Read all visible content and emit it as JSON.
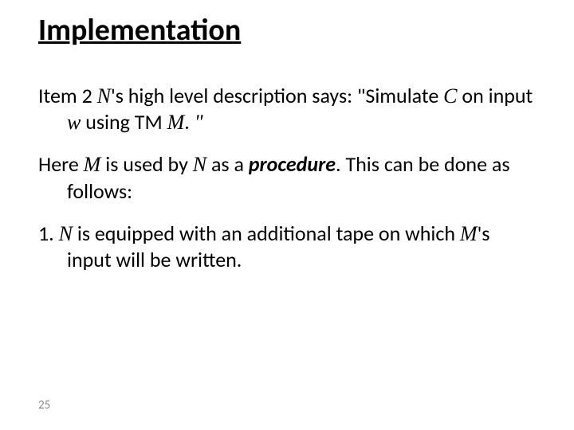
{
  "title": "Implementation",
  "p1": {
    "a": "Item 2 ",
    "N": "N",
    "b": "'s high level description says: \"Simulate ",
    "C": "C",
    "c": " on input ",
    "w": "w",
    "d": " using TM ",
    "M": "M",
    "e": ". ",
    "close": "\""
  },
  "p2": {
    "a": "Here ",
    "M": "M",
    "b": " is used by ",
    "N": "N",
    "c": " as a ",
    "proc": "procedure",
    "d": ". This can be done as follows:"
  },
  "p3": {
    "a": "1. ",
    "N": "N",
    "b": " is equipped with an additional tape on which ",
    "M": "M",
    "c": "'s input will be written."
  },
  "page": "25"
}
